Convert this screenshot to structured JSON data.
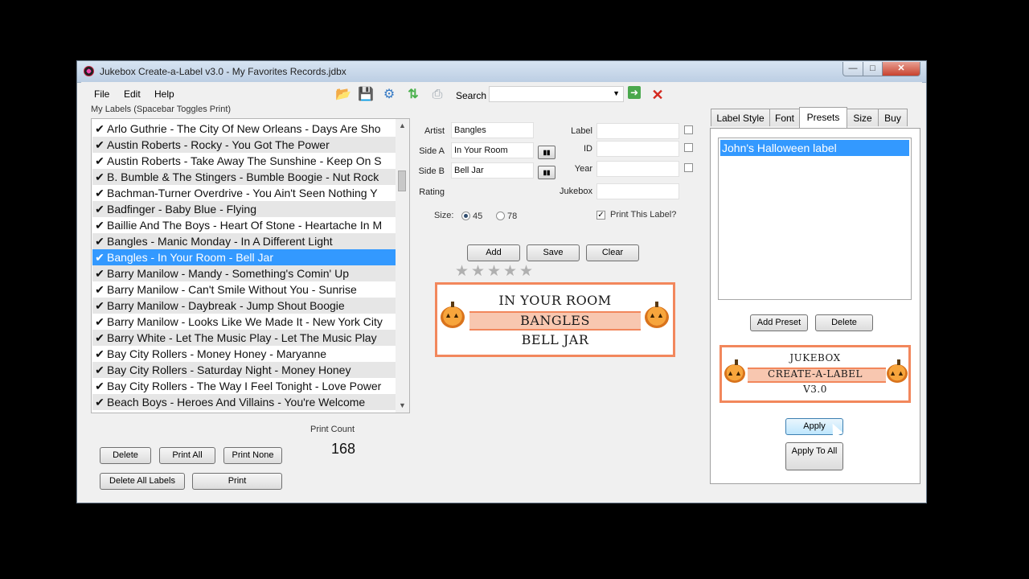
{
  "window": {
    "title": "Jukebox Create-a-Label v3.0 - My Favorites Records.jdbx"
  },
  "menu": {
    "file": "File",
    "edit": "Edit",
    "help": "Help"
  },
  "toolbar": {
    "icons": [
      "open-folder-icon",
      "save-icon",
      "settings-gear-icon",
      "sort-arrows-icon",
      "printer-icon"
    ],
    "search_label": "Search",
    "search_value": "",
    "go_icon": "go-arrow-icon",
    "clear_icon": "red-x-icon"
  },
  "labels_list": {
    "caption": "My Labels (Spacebar Toggles Print)",
    "items": [
      {
        "text": "Arlo Guthrie - The City Of New Orleans - Days Are Sho",
        "checked": true
      },
      {
        "text": "Austin Roberts - Rocky - You Got The Power",
        "checked": true
      },
      {
        "text": "Austin Roberts - Take Away The Sunshine - Keep On S",
        "checked": true
      },
      {
        "text": "B. Bumble & The Stingers - Bumble Boogie - Nut Rock",
        "checked": true
      },
      {
        "text": "Bachman-Turner Overdrive - You Ain't Seen Nothing Y",
        "checked": true
      },
      {
        "text": "Badfinger - Baby Blue - Flying",
        "checked": true
      },
      {
        "text": "Baillie And The Boys - Heart Of Stone - Heartache In M",
        "checked": true
      },
      {
        "text": "Bangles - Manic Monday - In A Different Light",
        "checked": true
      },
      {
        "text": "Bangles - In Your Room - Bell Jar",
        "checked": true,
        "selected": true
      },
      {
        "text": "Barry Manilow - Mandy - Something's Comin' Up",
        "checked": true
      },
      {
        "text": "Barry Manilow - Can't Smile Without You - Sunrise",
        "checked": true
      },
      {
        "text": "Barry Manilow - Daybreak - Jump Shout Boogie",
        "checked": true
      },
      {
        "text": "Barry Manilow - Looks Like We Made It - New York City",
        "checked": true
      },
      {
        "text": "Barry White - Let The Music Play - Let The Music Play",
        "checked": true
      },
      {
        "text": "Bay City Rollers - Money Honey - Maryanne",
        "checked": true
      },
      {
        "text": "Bay City Rollers - Saturday Night - Money Honey",
        "checked": true
      },
      {
        "text": "Bay City Rollers - The Way I Feel Tonight - Love Power",
        "checked": true
      },
      {
        "text": "Beach Boys - Heroes And Villains - You're Welcome",
        "checked": true
      }
    ]
  },
  "list_buttons": {
    "delete": "Delete",
    "print_all": "Print All",
    "print_none": "Print None",
    "delete_all": "Delete All Labels",
    "print": "Print"
  },
  "print_count": {
    "label": "Print Count",
    "value": "168"
  },
  "form": {
    "artist_label": "Artist",
    "artist_value": "Bangles",
    "side_a_label": "Side A",
    "side_a_value": "In Your Room",
    "side_b_label": "Side B",
    "side_b_value": "Bell Jar",
    "rating_label": "Rating",
    "rating_value": 0,
    "rating_max": 5,
    "label_label": "Label",
    "label_value": "",
    "id_label": "ID",
    "id_value": "",
    "year_label": "Year",
    "year_value": "",
    "jukebox_label": "Jukebox",
    "jukebox_value": "",
    "size_label": "Size:",
    "size_45": "45",
    "size_78": "78",
    "size_selected": "45",
    "print_this_label": "Print This Label?",
    "print_this_checked": true,
    "swap_icon": "swap-icon"
  },
  "form_buttons": {
    "add": "Add",
    "save": "Save",
    "clear": "Clear"
  },
  "label_preview": {
    "line1": "IN YOUR ROOM",
    "line2": "BANGLES",
    "line3": "BELL JAR"
  },
  "tabs": [
    "Label Style",
    "Font",
    "Presets",
    "Size",
    "Buy"
  ],
  "active_tab": "Presets",
  "presets": {
    "items": [
      "John's Halloween label"
    ],
    "selected": "John's Halloween label",
    "add_preset": "Add Preset",
    "delete": "Delete",
    "apply": "Apply",
    "apply_to_all": "Apply To All"
  },
  "preset_preview": {
    "line1": "JUKEBOX",
    "line2": "CREATE-A-LABEL",
    "line3": "V3.0"
  },
  "colors": {
    "label_border": "#f2875c",
    "label_band": "#f8c7b0",
    "selection": "#3399ff"
  }
}
